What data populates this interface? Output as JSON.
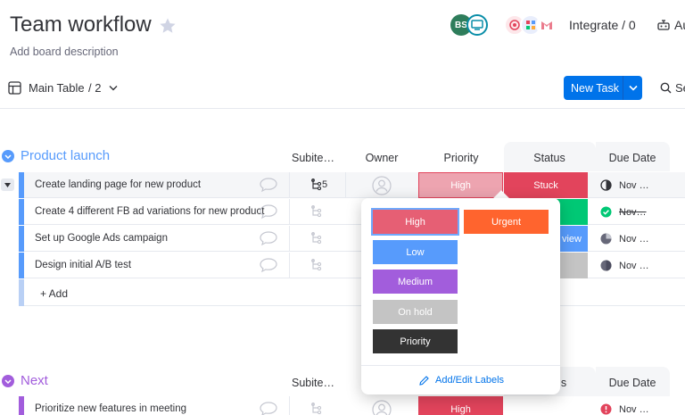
{
  "header": {
    "title": "Team workflow",
    "description": "Add board description",
    "avatar_initials": "BS",
    "integrate_label": "Integrate / 0",
    "automate_label": "Au"
  },
  "toolbar": {
    "view_label": "Main Table",
    "view_count": "/ 2",
    "new_task_label": "New Task",
    "search_label": "Se"
  },
  "columns": {
    "subitems": "Subite…",
    "owner": "Owner",
    "priority": "Priority",
    "status": "Status",
    "due_date": "Due Date",
    "status_partial": "s"
  },
  "groups": [
    {
      "title": "Product launch",
      "color": "#579bfc",
      "items": [
        {
          "name": "Create landing page for new product",
          "subitems": "5",
          "priority": "High",
          "status": "Stuck",
          "due": "Nov …"
        },
        {
          "name": "Create 4 different FB ad variations for new product",
          "subitems": "",
          "priority": "",
          "status": "",
          "due": "Nov…"
        },
        {
          "name": "Set up Google Ads campaign",
          "subitems": "",
          "priority": "",
          "status": "view",
          "due": "Nov …"
        },
        {
          "name": "Design initial A/B test",
          "subitems": "",
          "priority": "",
          "status": "",
          "due": "Nov …"
        }
      ],
      "add_label": "+ Add"
    },
    {
      "title": "Next",
      "color": "#a25ddc",
      "items": [
        {
          "name": "Prioritize new features in meeting",
          "subitems": "",
          "priority": "High",
          "status": "",
          "due": "Nov …"
        }
      ]
    }
  ],
  "priority_dropdown": {
    "options": [
      {
        "label": "High",
        "color": "#e2445c",
        "selected": true
      },
      {
        "label": "Urgent",
        "color": "#ff642e",
        "selected": false
      },
      {
        "label": "Low",
        "color": "#579bfc",
        "selected": false
      },
      {
        "label": "Medium",
        "color": "#a25ddc",
        "selected": false
      },
      {
        "label": "On hold",
        "color": "#c4c4c4",
        "selected": false
      },
      {
        "label": "Priority",
        "color": "#333333",
        "selected": false
      }
    ],
    "edit_label": "Add/Edit Labels"
  },
  "colors": {
    "accent": "#0073ea",
    "stuck": "#e2445c",
    "done": "#00c875",
    "working": "#579bfc",
    "empty": "#c4c4c4"
  }
}
